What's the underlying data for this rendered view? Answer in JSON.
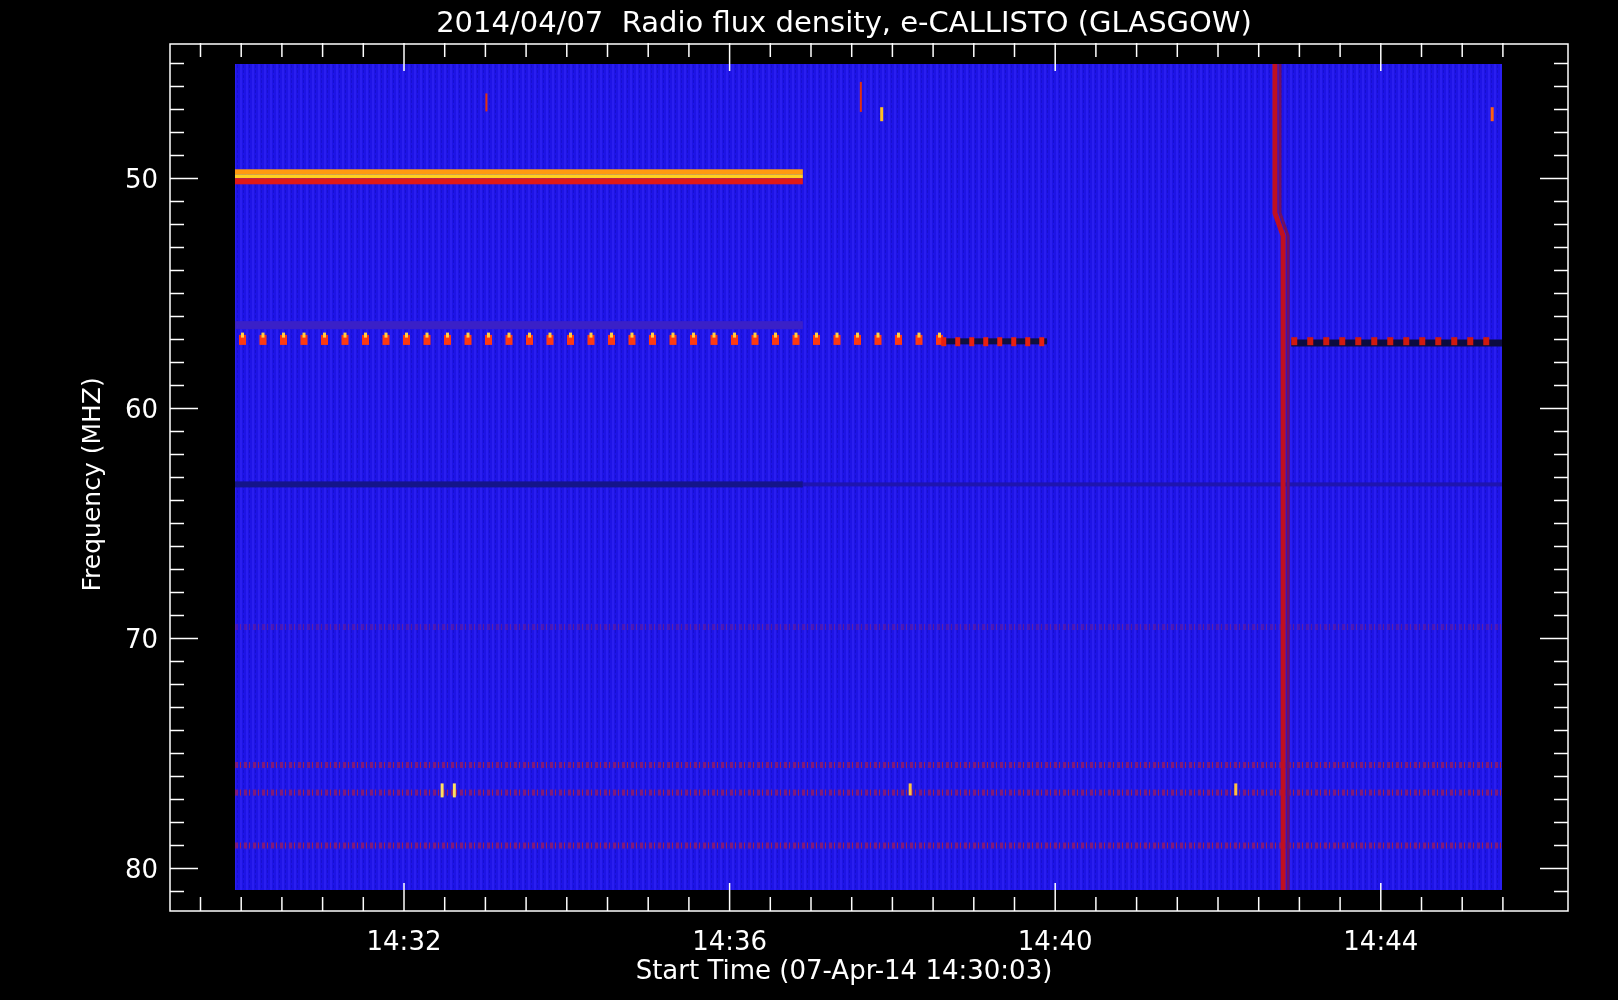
{
  "title": "2014/04/07  Radio flux density, e-CALLISTO (GLASGOW)",
  "y_axis": {
    "label": "Frequency (MHZ)",
    "ticks": [
      "50",
      "60",
      "70",
      "80"
    ]
  },
  "x_axis": {
    "label": "Start Time (07-Apr-14 14:30:03)",
    "ticks": [
      "14:32",
      "14:36",
      "14:40",
      "14:44"
    ]
  }
}
